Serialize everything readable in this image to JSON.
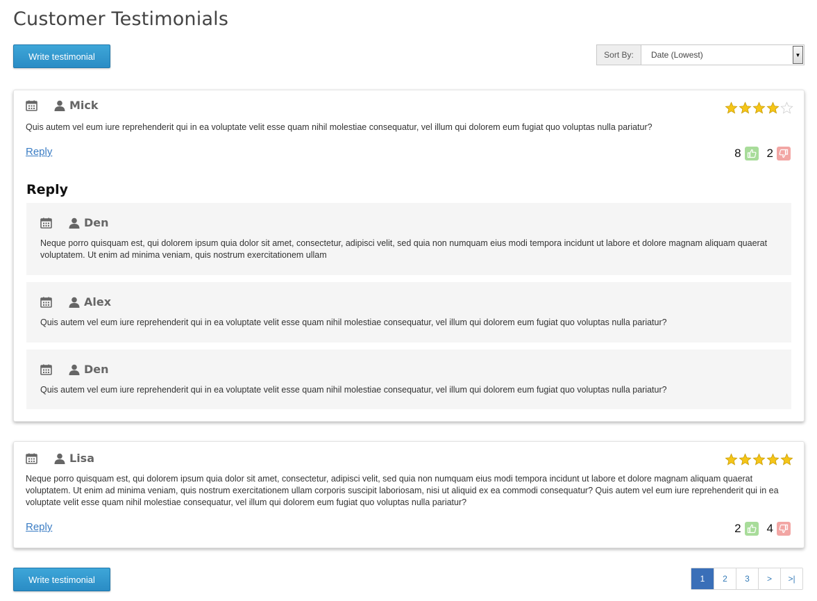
{
  "page": {
    "title": "Customer Testimonials"
  },
  "actions": {
    "write_label": "Write testimonial"
  },
  "sort": {
    "label": "Sort By:",
    "selected": "Date (Lowest)"
  },
  "colors": {
    "accent": "#2a8cc5",
    "star": "#f5c518",
    "thumb_up": "#a8dc9a",
    "thumb_down": "#f2a6a4",
    "link": "#3b7dc4"
  },
  "testimonials": [
    {
      "author": "Mick",
      "rating": 4,
      "text": "Quis autem vel eum iure reprehenderit qui in ea voluptate velit esse quam nihil molestiae consequatur, vel illum qui dolorem eum fugiat quo voluptas nulla pariatur?",
      "reply_label": "Reply",
      "likes": "8",
      "dislikes": "2",
      "replies_heading": "Reply",
      "replies": [
        {
          "author": "Den",
          "text": "Neque porro quisquam est, qui dolorem ipsum quia dolor sit amet, consectetur, adipisci velit, sed quia non numquam eius modi tempora incidunt ut labore et dolore magnam aliquam quaerat voluptatem. Ut enim ad minima veniam, quis nostrum exercitationem ullam"
        },
        {
          "author": "Alex",
          "text": "Quis autem vel eum iure reprehenderit qui in ea voluptate velit esse quam nihil molestiae consequatur, vel illum qui dolorem eum fugiat quo voluptas nulla pariatur?"
        },
        {
          "author": "Den",
          "text": "Quis autem vel eum iure reprehenderit qui in ea voluptate velit esse quam nihil molestiae consequatur, vel illum qui dolorem eum fugiat quo voluptas nulla pariatur?"
        }
      ]
    },
    {
      "author": "Lisa",
      "rating": 5,
      "text": "Neque porro quisquam est, qui dolorem ipsum quia dolor sit amet, consectetur, adipisci velit, sed quia non numquam eius modi tempora incidunt ut labore et dolore magnam aliquam quaerat voluptatem. Ut enim ad minima veniam, quis nostrum exercitationem ullam corporis suscipit laboriosam, nisi ut aliquid ex ea commodi consequatur? Quis autem vel eum iure reprehenderit qui in ea voluptate velit esse quam nihil molestiae consequatur, vel illum qui dolorem eum fugiat quo voluptas nulla pariatur?",
      "reply_label": "Reply",
      "likes": "2",
      "dislikes": "4"
    }
  ],
  "pagination": {
    "pages": [
      "1",
      "2",
      "3"
    ],
    "next": ">",
    "last": ">|",
    "current": "1"
  }
}
